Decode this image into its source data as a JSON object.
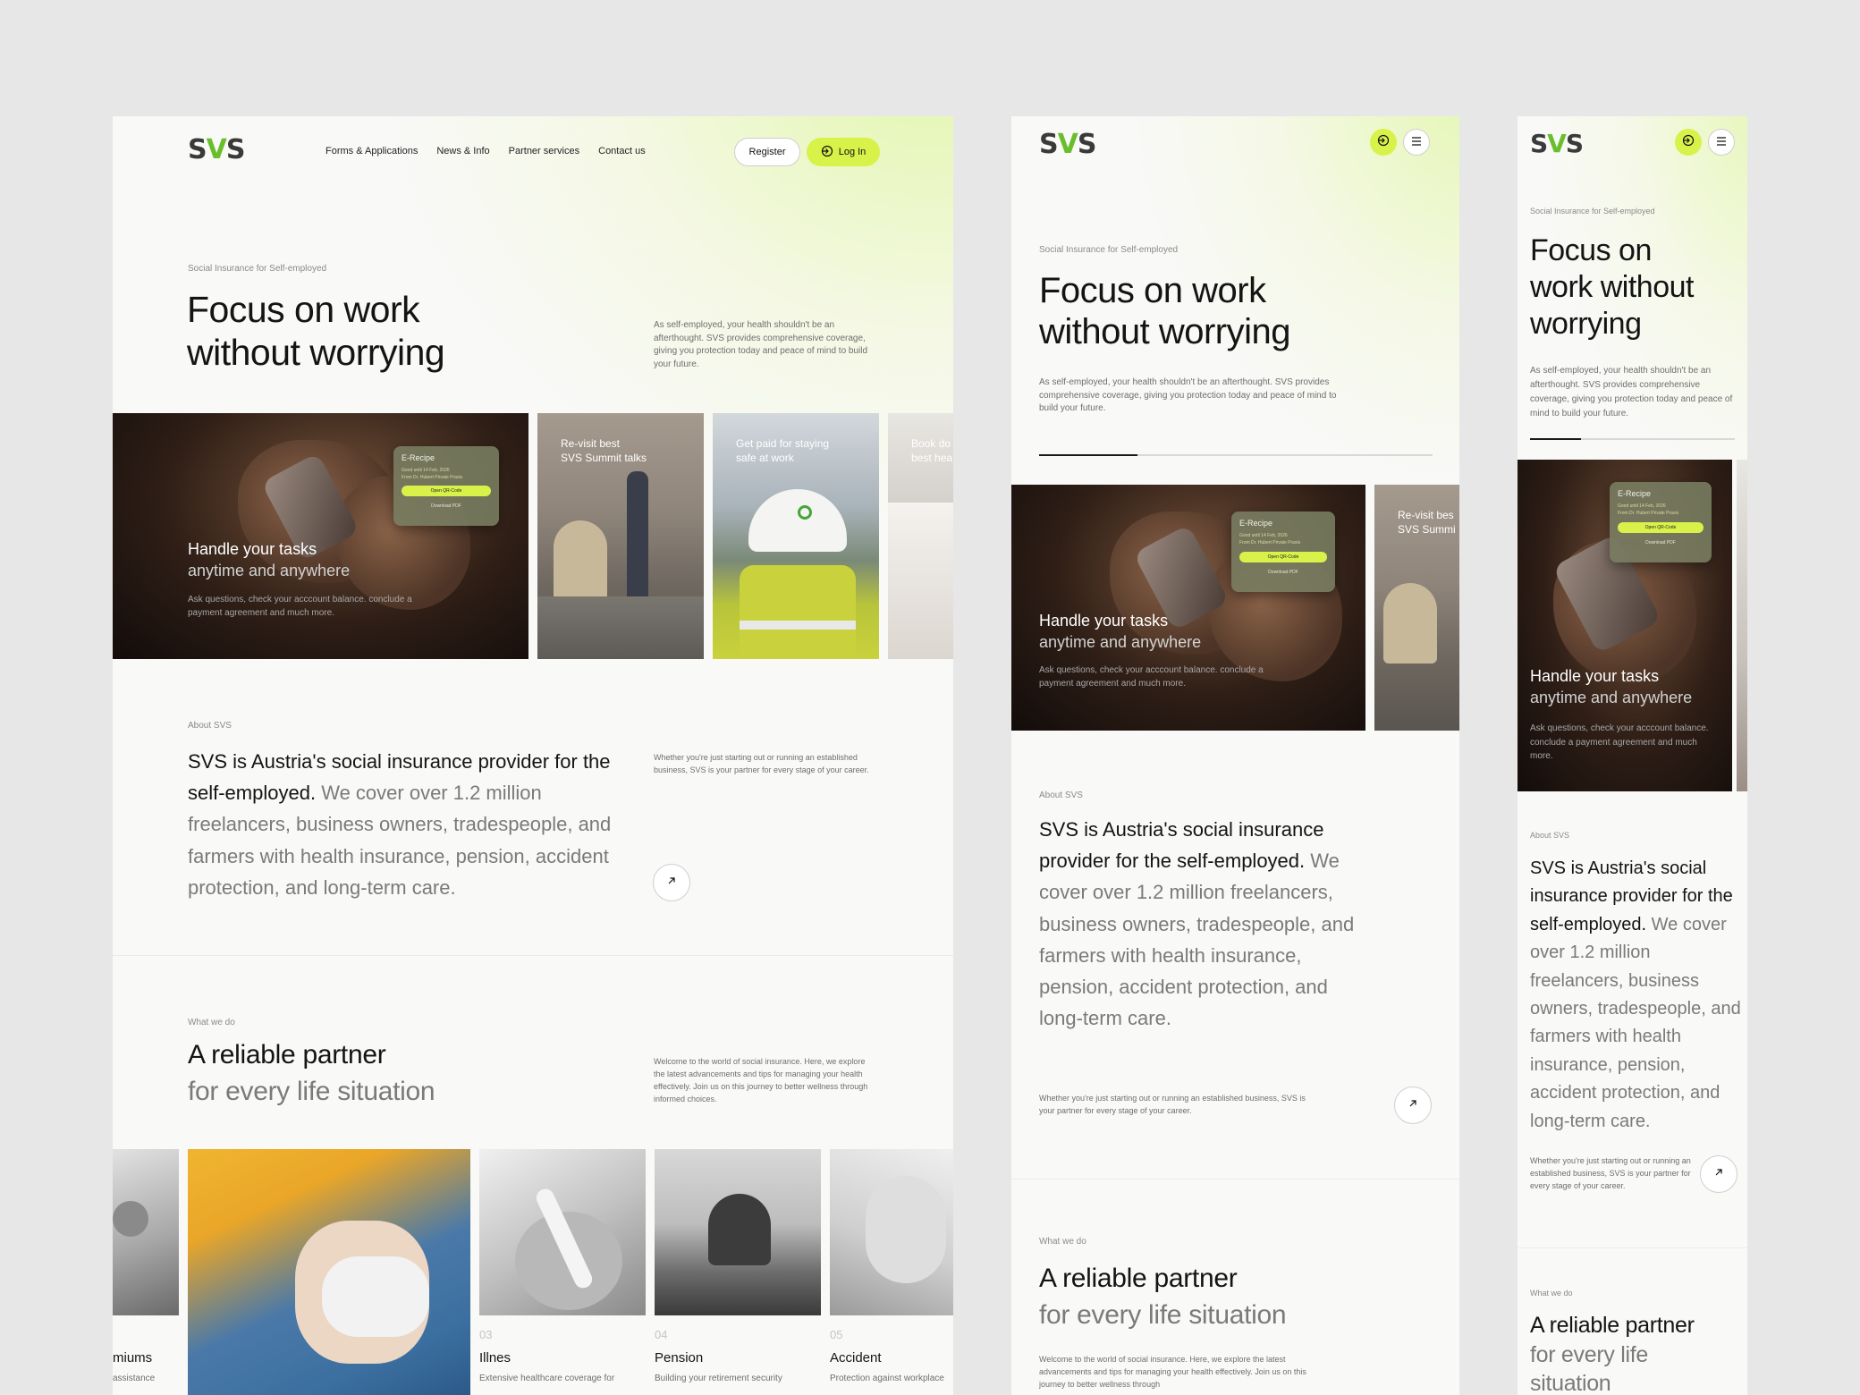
{
  "brand": {
    "logo_left": "S",
    "logo_v": "V",
    "logo_right": "S"
  },
  "colors": {
    "accent": "#d8f24a",
    "logo_green": "#6abe2c",
    "background": "#e7e7e7"
  },
  "icons": {
    "login": "login-arrow-icon",
    "menu": "hamburger-menu-icon",
    "open": "arrow-up-right-icon"
  },
  "nav": {
    "items": [
      "Forms & Applications",
      "News & Info",
      "Partner services",
      "Contact us"
    ],
    "register": "Register",
    "login": "Log In"
  },
  "hero": {
    "eyebrow": "Social Insurance for Self-employed",
    "title_1": "Focus on work",
    "title_2": "without worrying",
    "mobile_title_1": "Focus on",
    "mobile_title_2": "work without",
    "mobile_title_3": "worrying",
    "text": "As self-employed, your health shouldn't be an afterthought. SVS provides comprehensive coverage, giving you protection today and peace of mind to build your future.",
    "progress": 0.25
  },
  "cards": {
    "main": {
      "title": "Handle your tasks",
      "subtitle": "anytime and anywhere",
      "text": "Ask questions, check your acccount balance. conclude a payment agreement and much more."
    },
    "erecipe": {
      "title": "E-Recipe",
      "valid": "Good until 14 Feb, 2026",
      "from": "From Dr. Hubert Private Praxis",
      "open": "Open QR-Code",
      "download": "Download PDF"
    },
    "c2": {
      "title_1": "Re-visit best",
      "title_2": "SVS Summit talks",
      "tablet_1": "Re-visit bes",
      "tablet_2": "SVS Summi"
    },
    "c3": {
      "title_1": "Get paid for staying",
      "title_2": "safe at work"
    },
    "c4": {
      "title_1": "Book do",
      "title_2": "best hea"
    }
  },
  "about": {
    "eyebrow": "About SVS",
    "lead_dark": "SVS is Austria's social insurance provider for the self-employed.",
    "lead_gray": "We cover over 1.2 million freelancers, business owners, tradespeople, and farmers with health insurance, pension, accident protection, and long-term care.",
    "side": "Whether you're just starting out or running an established business, SVS is your partner for every stage of your career."
  },
  "what": {
    "eyebrow": "What we do",
    "title_dark": "A reliable partner",
    "title_gray": "for every life situation",
    "text": "Welcome to the world of social insurance. Here, we explore the latest advancements and tips for managing your health effectively. Join us on this journey to better wellness through informed choices.",
    "tablet_text": "Welcome to the world of social insurance. Here, we explore the latest advancements and tips for managing your health effectively. Join us on this journey to better wellness through",
    "mobile_title_1": "A reliable partner",
    "mobile_title_2": "for every life",
    "mobile_title_3": "situation"
  },
  "services": [
    {
      "num": "",
      "name": "miums",
      "desc": "assistance"
    },
    {
      "num": "",
      "name": "",
      "desc": ""
    },
    {
      "num": "03",
      "name": "Illnes",
      "desc": "Extensive healthcare coverage for"
    },
    {
      "num": "04",
      "name": "Pension",
      "desc": "Building your retirement security"
    },
    {
      "num": "05",
      "name": "Accident",
      "desc": "Protection against workplace"
    }
  ]
}
